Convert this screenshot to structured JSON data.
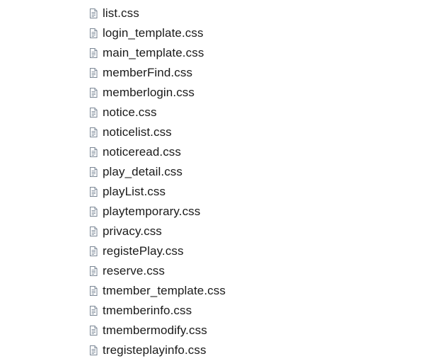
{
  "file_icon": "css-file-icon",
  "files": [
    {
      "name": "list.css"
    },
    {
      "name": "login_template.css"
    },
    {
      "name": "main_template.css"
    },
    {
      "name": "memberFind.css"
    },
    {
      "name": "memberlogin.css"
    },
    {
      "name": "notice.css"
    },
    {
      "name": "noticelist.css"
    },
    {
      "name": "noticeread.css"
    },
    {
      "name": "play_detail.css"
    },
    {
      "name": "playList.css"
    },
    {
      "name": "playtemporary.css"
    },
    {
      "name": "privacy.css"
    },
    {
      "name": "registePlay.css"
    },
    {
      "name": "reserve.css"
    },
    {
      "name": "tmember_template.css"
    },
    {
      "name": "tmemberinfo.css"
    },
    {
      "name": "tmembermodify.css"
    },
    {
      "name": "tregisteplayinfo.css"
    }
  ]
}
